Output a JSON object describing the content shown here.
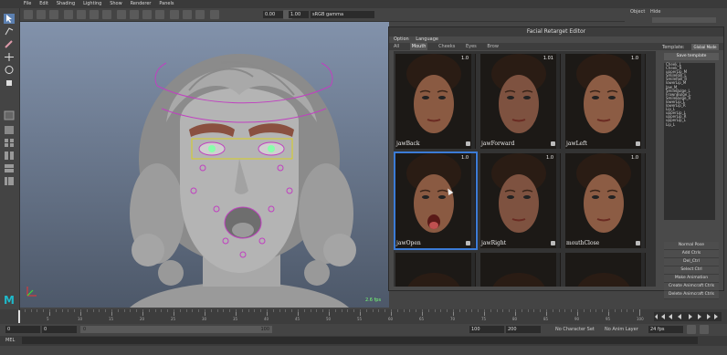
{
  "menubar": {
    "items": [
      "File",
      "Edit",
      "Shading",
      "Lighting",
      "Show",
      "Renderer",
      "Panels"
    ]
  },
  "statusline": {
    "time_field": "0.00",
    "scale_field": "1.00",
    "color_space": "sRGB gamma"
  },
  "right_panel": {
    "tabs": [
      "Object",
      "Hide"
    ]
  },
  "editor": {
    "title": "Facial Retarget Editor",
    "menu": [
      "Option",
      "Language"
    ],
    "tabs": [
      "All",
      "Mouth",
      "Cheeks",
      "Eyes",
      "Brow"
    ],
    "active_tab": "Mouth",
    "template_label": "Template:",
    "template_value": "Global Mode",
    "save_button": "Save template",
    "shapes": [
      {
        "label": "jawBack",
        "value": "1.0"
      },
      {
        "label": "jawForward",
        "value": "1.01"
      },
      {
        "label": "jawLeft",
        "value": "1.0"
      },
      {
        "label": "jawOpen",
        "value": "1.0"
      },
      {
        "label": "jawRight",
        "value": "1.0"
      },
      {
        "label": "mouthClose",
        "value": "1.0"
      },
      {
        "label": "",
        "value": ""
      },
      {
        "label": "",
        "value": ""
      },
      {
        "label": "",
        "value": ""
      }
    ],
    "shape_list": [
      "Cheek_L",
      "Cheek_R",
      "upperLip_M",
      "SmileRoll_L",
      "SmileRoll_R",
      "lowerLip_M",
      "Jaw_M",
      "SmileBulge_L",
      "FrownBulge_L",
      "SmileBulge_R",
      "lowerLip_L",
      "lowerLip_R",
      "Lip_L",
      "upperLip_L",
      "upperLip_R",
      "upperLip_L",
      "Lip_L"
    ],
    "actions": [
      "Normal Pose",
      "Add Ctrls",
      "Del_Ctrl",
      "Select Ctrl",
      "Make Animation",
      "Create Animcraft Ctrls",
      "Delete Animcraft Ctrls"
    ]
  },
  "viewport": {
    "fps": "2.6 fps"
  },
  "timeline": {
    "start": "0",
    "current": "0",
    "range_start": "0",
    "range_end": "100",
    "end1": "100",
    "end2": "200",
    "char_set": "No Character Set",
    "anim_layer": "No Anim Layer",
    "fps_setting": "24 fps",
    "ticks": [
      "5",
      "10",
      "15",
      "20",
      "25",
      "30",
      "35",
      "40",
      "45",
      "50",
      "55",
      "60",
      "65",
      "70",
      "75",
      "80",
      "85",
      "90",
      "95",
      "100"
    ]
  },
  "cmdline": {
    "label": "MEL"
  },
  "colors": {
    "selection": "#3b7bd6",
    "viewport_top": "#8292ab",
    "viewport_bottom": "#4d5869",
    "maya_logo": "#1fb8c9"
  }
}
